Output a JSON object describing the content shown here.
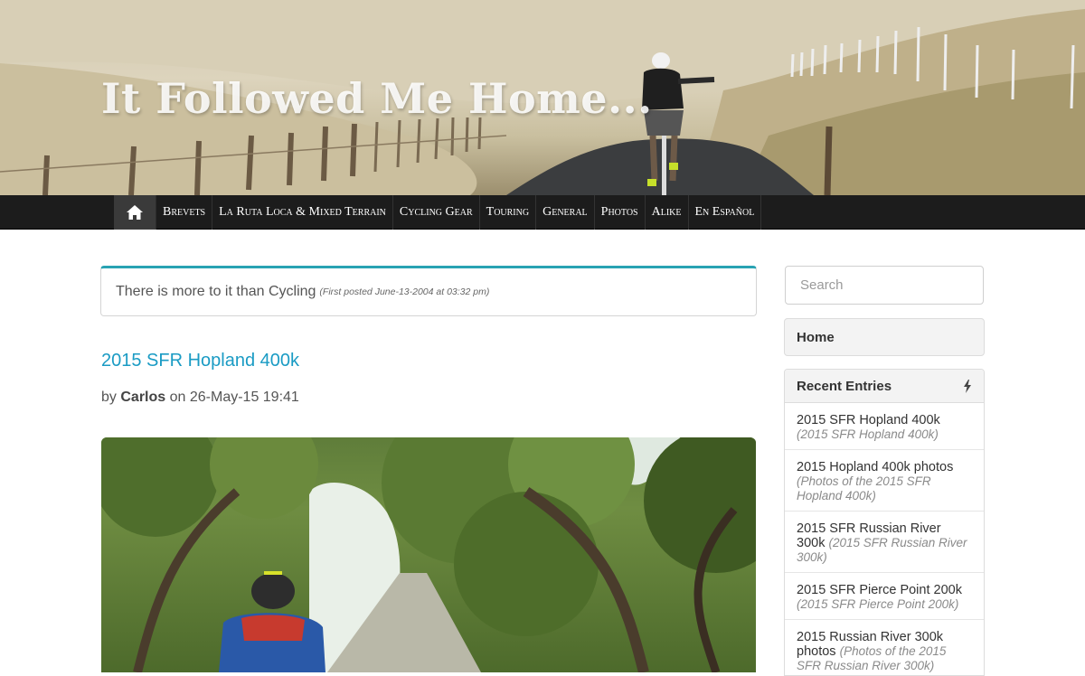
{
  "site": {
    "title": "It Followed Me Home..."
  },
  "nav": {
    "home_icon": "home-icon",
    "items": [
      "Brevets",
      "La Ruta Loca & Mixed Terrain",
      "Cycling Gear",
      "Touring",
      "General",
      "Photos",
      "Alike",
      "En Español"
    ]
  },
  "notice": {
    "text": "There is more to it than Cycling",
    "meta": "(First posted June-13-2004 at 03:32 pm)"
  },
  "post": {
    "title": "2015 SFR Hopland 400k",
    "by": "by",
    "author": "Carlos",
    "on": "on",
    "date": "26-May-15 19:41"
  },
  "sidebar": {
    "search_placeholder": "Search",
    "home_label": "Home",
    "recent_title": "Recent Entries",
    "recent_icon": "lightning-icon",
    "recent": [
      {
        "title": "2015 SFR Hopland 400k",
        "sub": "(2015 SFR Hopland 400k)"
      },
      {
        "title": "2015 Hopland 400k photos",
        "sub": "(Photos of the 2015 SFR Hopland 400k)"
      },
      {
        "title": "2015 SFR Russian River 300k",
        "sub": "(2015 SFR Russian River 300k)"
      },
      {
        "title": "2015 SFR Pierce Point 200k",
        "sub": "(2015 SFR Pierce Point 200k)"
      },
      {
        "title": "2015 Russian River 300k photos",
        "sub": "(Photos of the 2015 SFR Russian River 300k)"
      }
    ]
  },
  "colors": {
    "accent": "#29a3b3",
    "link": "#1a9bc4",
    "navbar": "#1c1c1c"
  }
}
